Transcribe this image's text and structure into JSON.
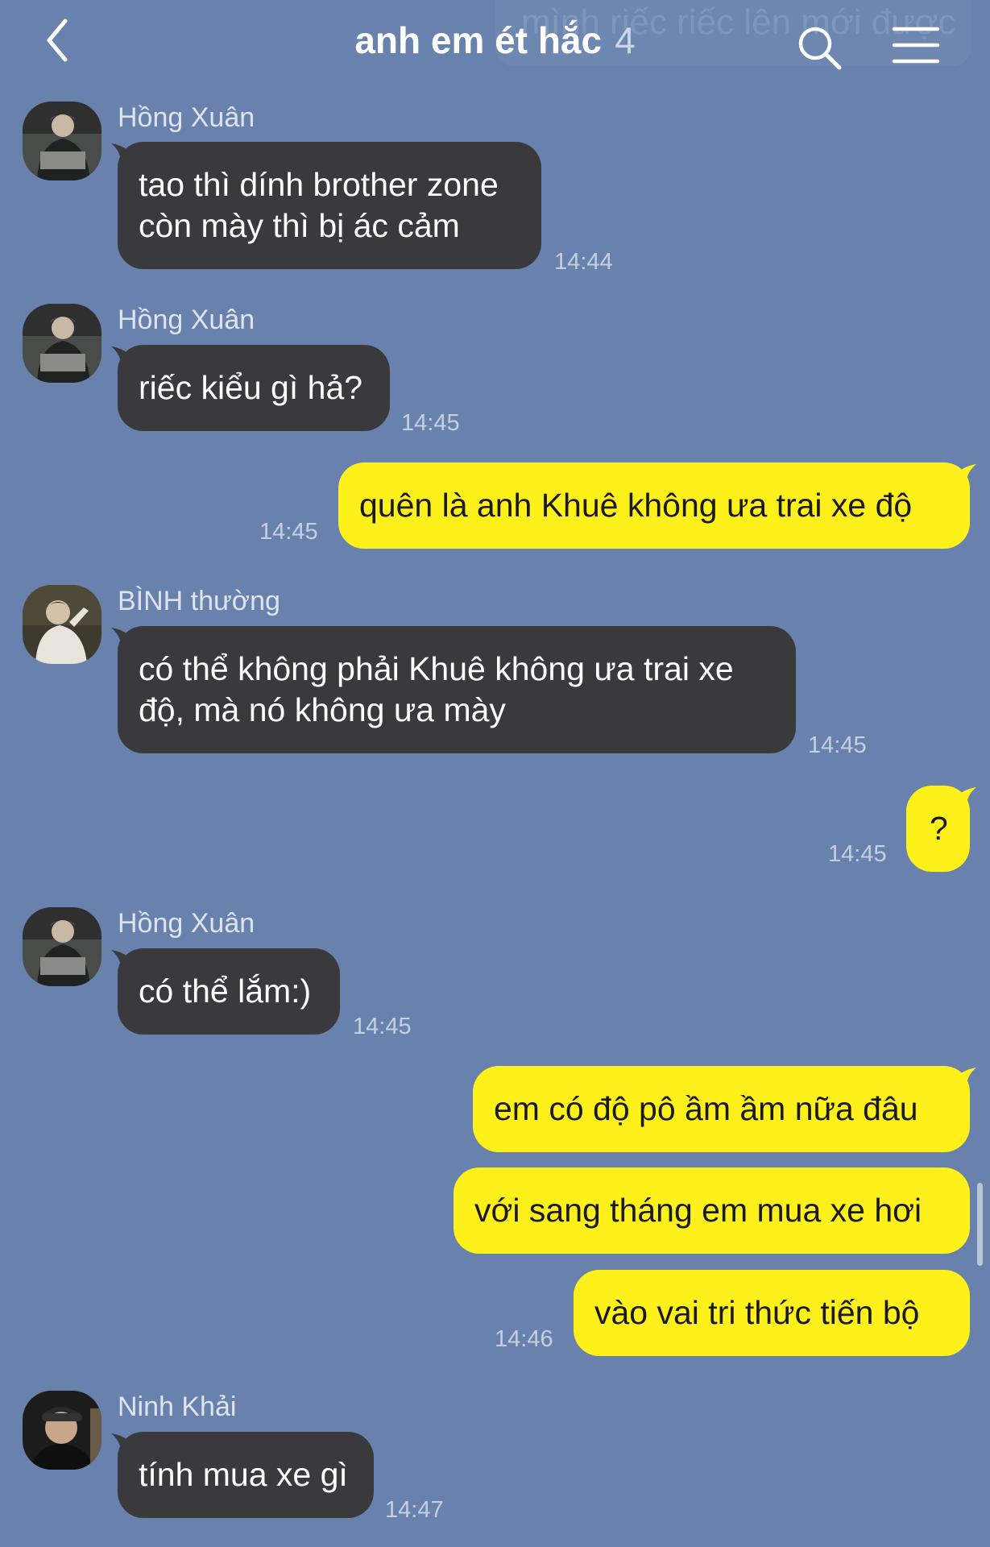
{
  "header": {
    "title": "anh em ét hắc",
    "member_count": "4",
    "ghost_preview": "mình riếc riếc lên mới được"
  },
  "messages": [
    {
      "sender": "Hồng Xuân",
      "lines": [
        "tao thì dính brother zone",
        "còn mày thì bị ác cảm"
      ],
      "time": "14:44"
    },
    {
      "sender": "Hồng Xuân",
      "lines": [
        "riếc kiểu gì hả?"
      ],
      "time": "14:45"
    },
    {
      "lines": [
        "quên là anh Khuê không ưa trai xe độ"
      ],
      "time": "14:45"
    },
    {
      "sender": "BÌNH thường",
      "lines": [
        "có thể không phải Khuê không ưa trai xe",
        "độ, mà nó không ưa mày"
      ],
      "time": "14:45"
    },
    {
      "lines": [
        "?"
      ],
      "time": "14:45"
    },
    {
      "sender": "Hồng Xuân",
      "lines": [
        "có thể lắm:)"
      ],
      "time": "14:45"
    },
    {
      "lines": [
        "em có độ pô ầm ầm nữa đâu"
      ]
    },
    {
      "lines": [
        "với sang tháng em mua xe hơi"
      ]
    },
    {
      "lines": [
        "vào vai tri thức tiến bộ"
      ],
      "time": "14:46"
    },
    {
      "sender": "Ninh Khải",
      "lines": [
        "tính mua xe gì"
      ],
      "time": "14:47"
    }
  ],
  "colors": {
    "background": "#6882ad",
    "incoming_bubble": "#3a3a3d",
    "outgoing_bubble": "#fef01b"
  },
  "icons": [
    "back-chevron-icon",
    "search-icon",
    "menu-icon"
  ]
}
